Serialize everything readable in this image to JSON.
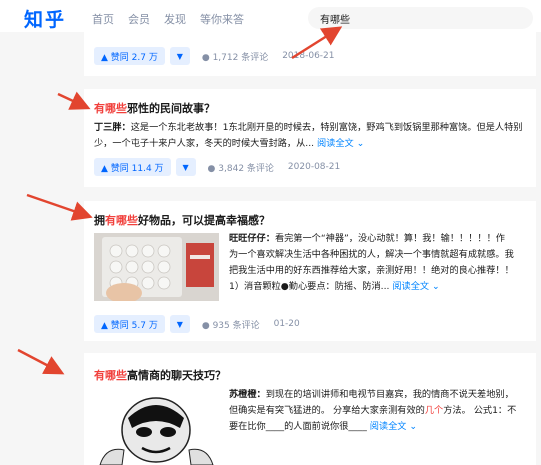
{
  "header": {
    "logo": "知乎",
    "nav": [
      "首页",
      "会员",
      "发现",
      "等你来答"
    ],
    "search_value": "有哪些"
  },
  "cards": [
    {
      "vote": "▲ 赞同 2.7 万",
      "comments": "1,712 条评论",
      "date": "2018-06-21"
    },
    {
      "title_hl": "有哪些",
      "title_rest": "邪性的民间故事？",
      "author": "丁三胖：",
      "excerpt1": "这是一个东北老故事！1东北刚开垦的时候去，特别富饶，野鸡飞到饭锅里那种富饶。但是人特别",
      "excerpt2": "少，一个屯子十来户人家，冬天的时候大雪封路，从... ",
      "readmore": "阅读全文",
      "vote": "▲ 赞同 11.4 万",
      "comments": "3,842 条评论",
      "date": "2020-08-21"
    },
    {
      "title_pre": "拥",
      "title_hl": "有哪些",
      "title_rest": "好物品，可以提高幸福感？",
      "author": "旺旺仔仔：",
      "excerpt1": "看完第一个“神器”，没心动就！算！我！输！！！！！作",
      "excerpt2": "为一个喜欢解决生活中各种困扰的人，解决一个事情就超有成就感。我",
      "excerpt3": "把我生活中用的好东西推荐给大家，亲测好用！！绝对的良心推荐！！",
      "excerpt4": "1）消音颗粒●勤心要点：防摇、防消... ",
      "readmore": "阅读全文",
      "vote": "▲ 赞同 5.7 万",
      "comments": "935 条评论",
      "date": "01-20"
    },
    {
      "title_hl": "有哪些",
      "title_rest": "高情商的聊天技巧？",
      "author": "苏橙橙：",
      "excerpt1": "到现在的培训讲师和电视节目嘉宾，我的情商不说天差地别，",
      "excerpt2a": "但确实是有突飞猛进的。 分享给大家亲测有效的",
      "excerpt2hl": "几个",
      "excerpt2b": "方法。 公式1：不",
      "excerpt3": "要在比你____的人面前说你很____ ",
      "readmore": "阅读全文"
    }
  ],
  "colors": {
    "brand": "#0066ff",
    "highlight": "#f1403c",
    "arrow": "#e2452f"
  }
}
